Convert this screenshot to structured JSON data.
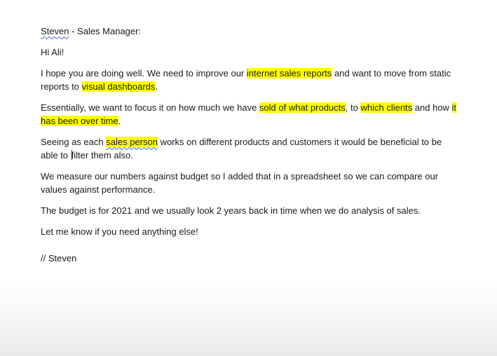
{
  "email": {
    "header": {
      "name": "Steven",
      "role": " - Sales Manager:"
    },
    "greeting": "Hi Ali!",
    "p1": {
      "t1": "I hope you are doing well. We need to improve our ",
      "h1": "internet sales reports",
      "t2": " and want to move from static reports to ",
      "h2": "visual dashboards",
      "t3": "."
    },
    "p2": {
      "t1": "Essentially, we want to focus it on how much we have ",
      "h1": "sold of what products",
      "t2": ", to ",
      "h2": "which clients",
      "t3": " and how ",
      "h3": "it has been over time",
      "t4": "."
    },
    "p3": {
      "t1": "Seeing as each ",
      "h1": "sales person",
      "t2": " works on different products and customers it would be beneficial to be able to ",
      "t3": "filter them also."
    },
    "p4": "We measure our numbers against budget so I added that in a spreadsheet so we can compare our values against performance.",
    "p5": "The budget is for 2021 and we usually look 2 years back in time when we do analysis of sales.",
    "p6": "Let me know if you need anything else!",
    "signoff": "// Steven"
  },
  "colors": {
    "highlight": "#ffff00",
    "text": "#1a1a1a",
    "spellcheck_underline": "#6f8fd8"
  }
}
